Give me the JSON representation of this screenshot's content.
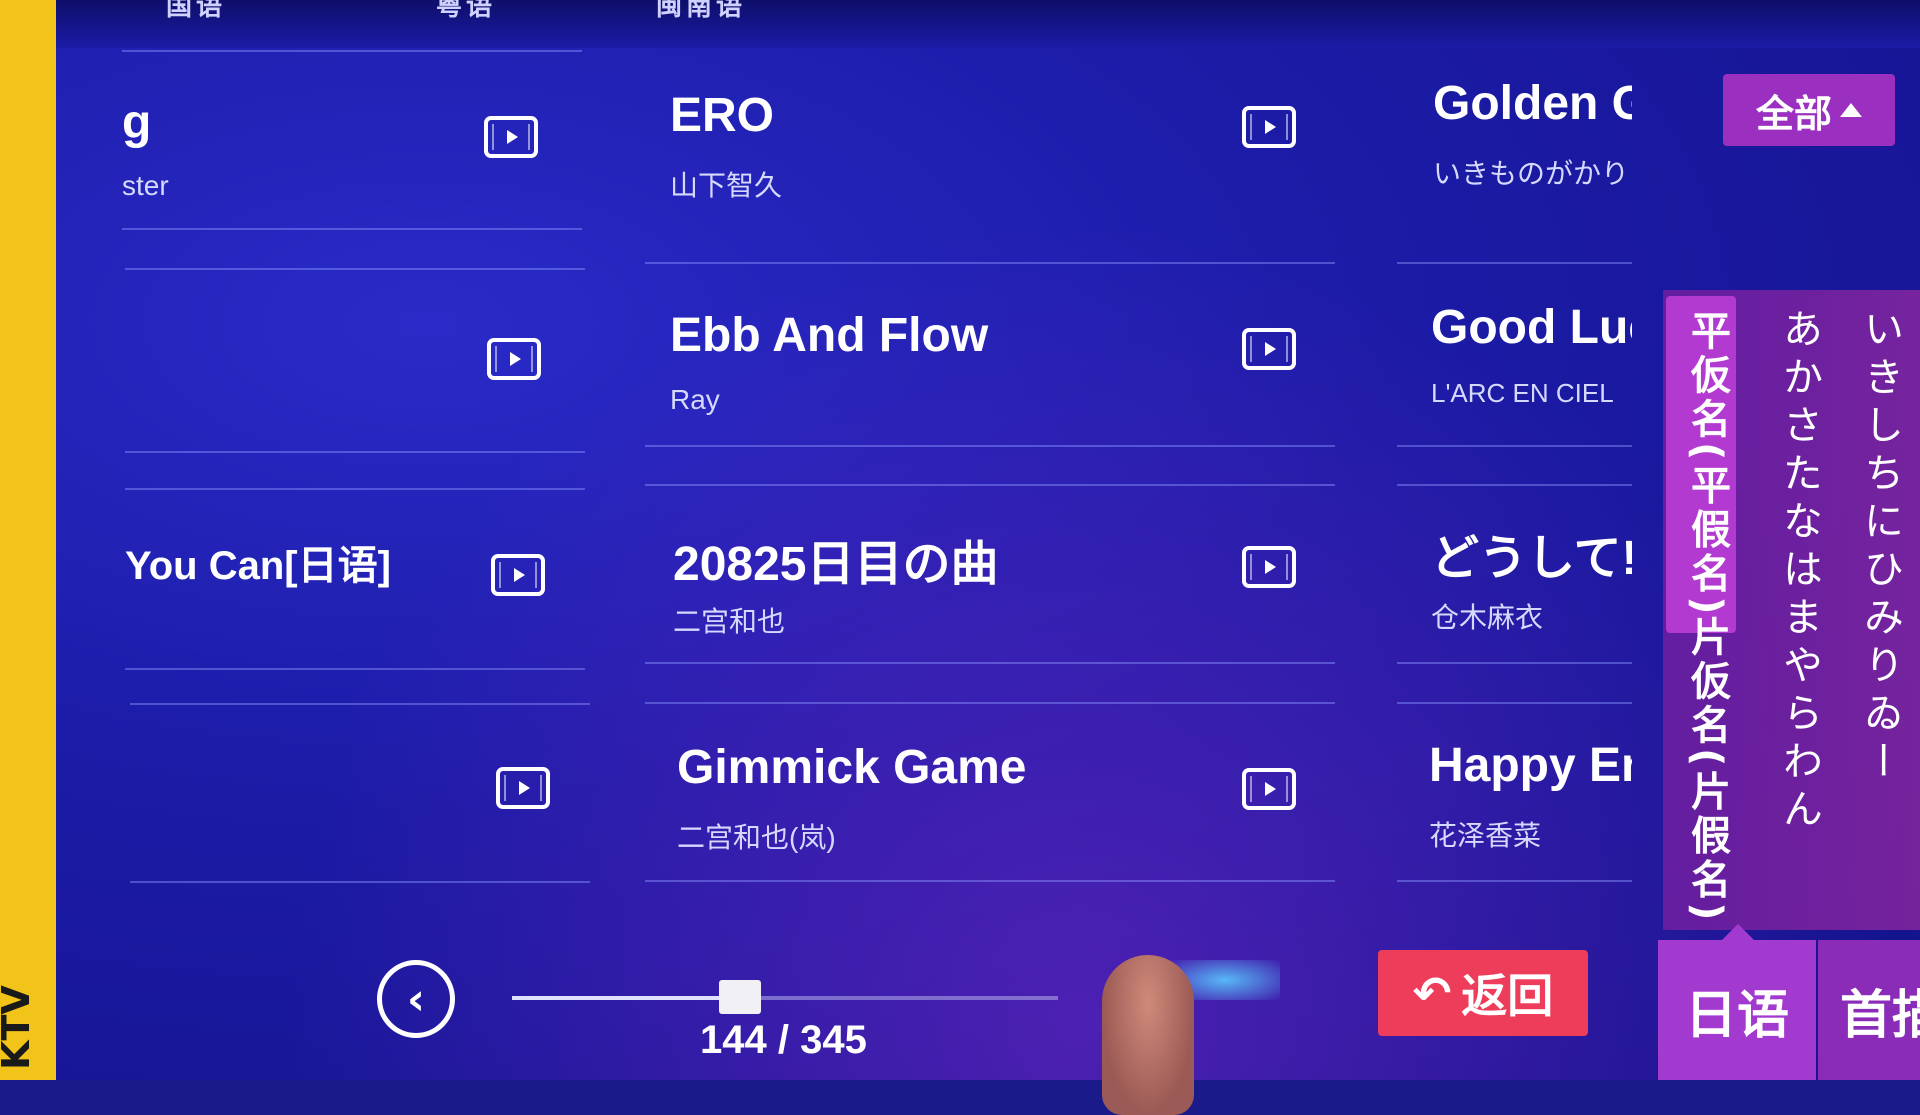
{
  "top_strip": {
    "cut_labels": [
      "国语",
      "粤语",
      "闽南语"
    ]
  },
  "columns": [
    {
      "songs": [
        {
          "title": "g",
          "artist": "ster"
        },
        {
          "title": "",
          "artist": ""
        },
        {
          "title": "You Can[日语]",
          "artist": ""
        },
        {
          "title": "",
          "artist": ""
        }
      ]
    },
    {
      "songs": [
        {
          "title": "ERO",
          "artist": "山下智久"
        },
        {
          "title": "Ebb And Flow",
          "artist": "Ray"
        },
        {
          "title": "20825日目の曲",
          "artist": "二宫和也"
        },
        {
          "title": "Gimmick Game",
          "artist": "二宫和也(岚)"
        }
      ]
    },
    {
      "songs": [
        {
          "title": "Golden G",
          "artist": "いきものがかり"
        },
        {
          "title": "Good Luc",
          "artist": "L'ARC EN CIEL"
        },
        {
          "title": "どうして!",
          "artist": "仓木麻衣"
        },
        {
          "title": "Happy En",
          "artist": "花泽香菜"
        }
      ]
    }
  ],
  "filter": {
    "all_label": "全部"
  },
  "kana": {
    "tab_hiragana": "平仮名(平假名)",
    "tab_katakana": "片仮名(片假名)",
    "col1": "あかさたなはまやらわん",
    "col2": "いきしちにひみりゐー"
  },
  "bottom": {
    "back_label": "返回",
    "page_current": "144",
    "page_total": "345",
    "page_text": "144 / 345",
    "progress_fraction": 0.4174,
    "language_label": "日语",
    "home_label": "首描"
  },
  "icons": {
    "play": "video-play-icon",
    "prev": "chevron-left-icon",
    "back": "back-arrow-icon",
    "caret": "caret-up-icon"
  }
}
